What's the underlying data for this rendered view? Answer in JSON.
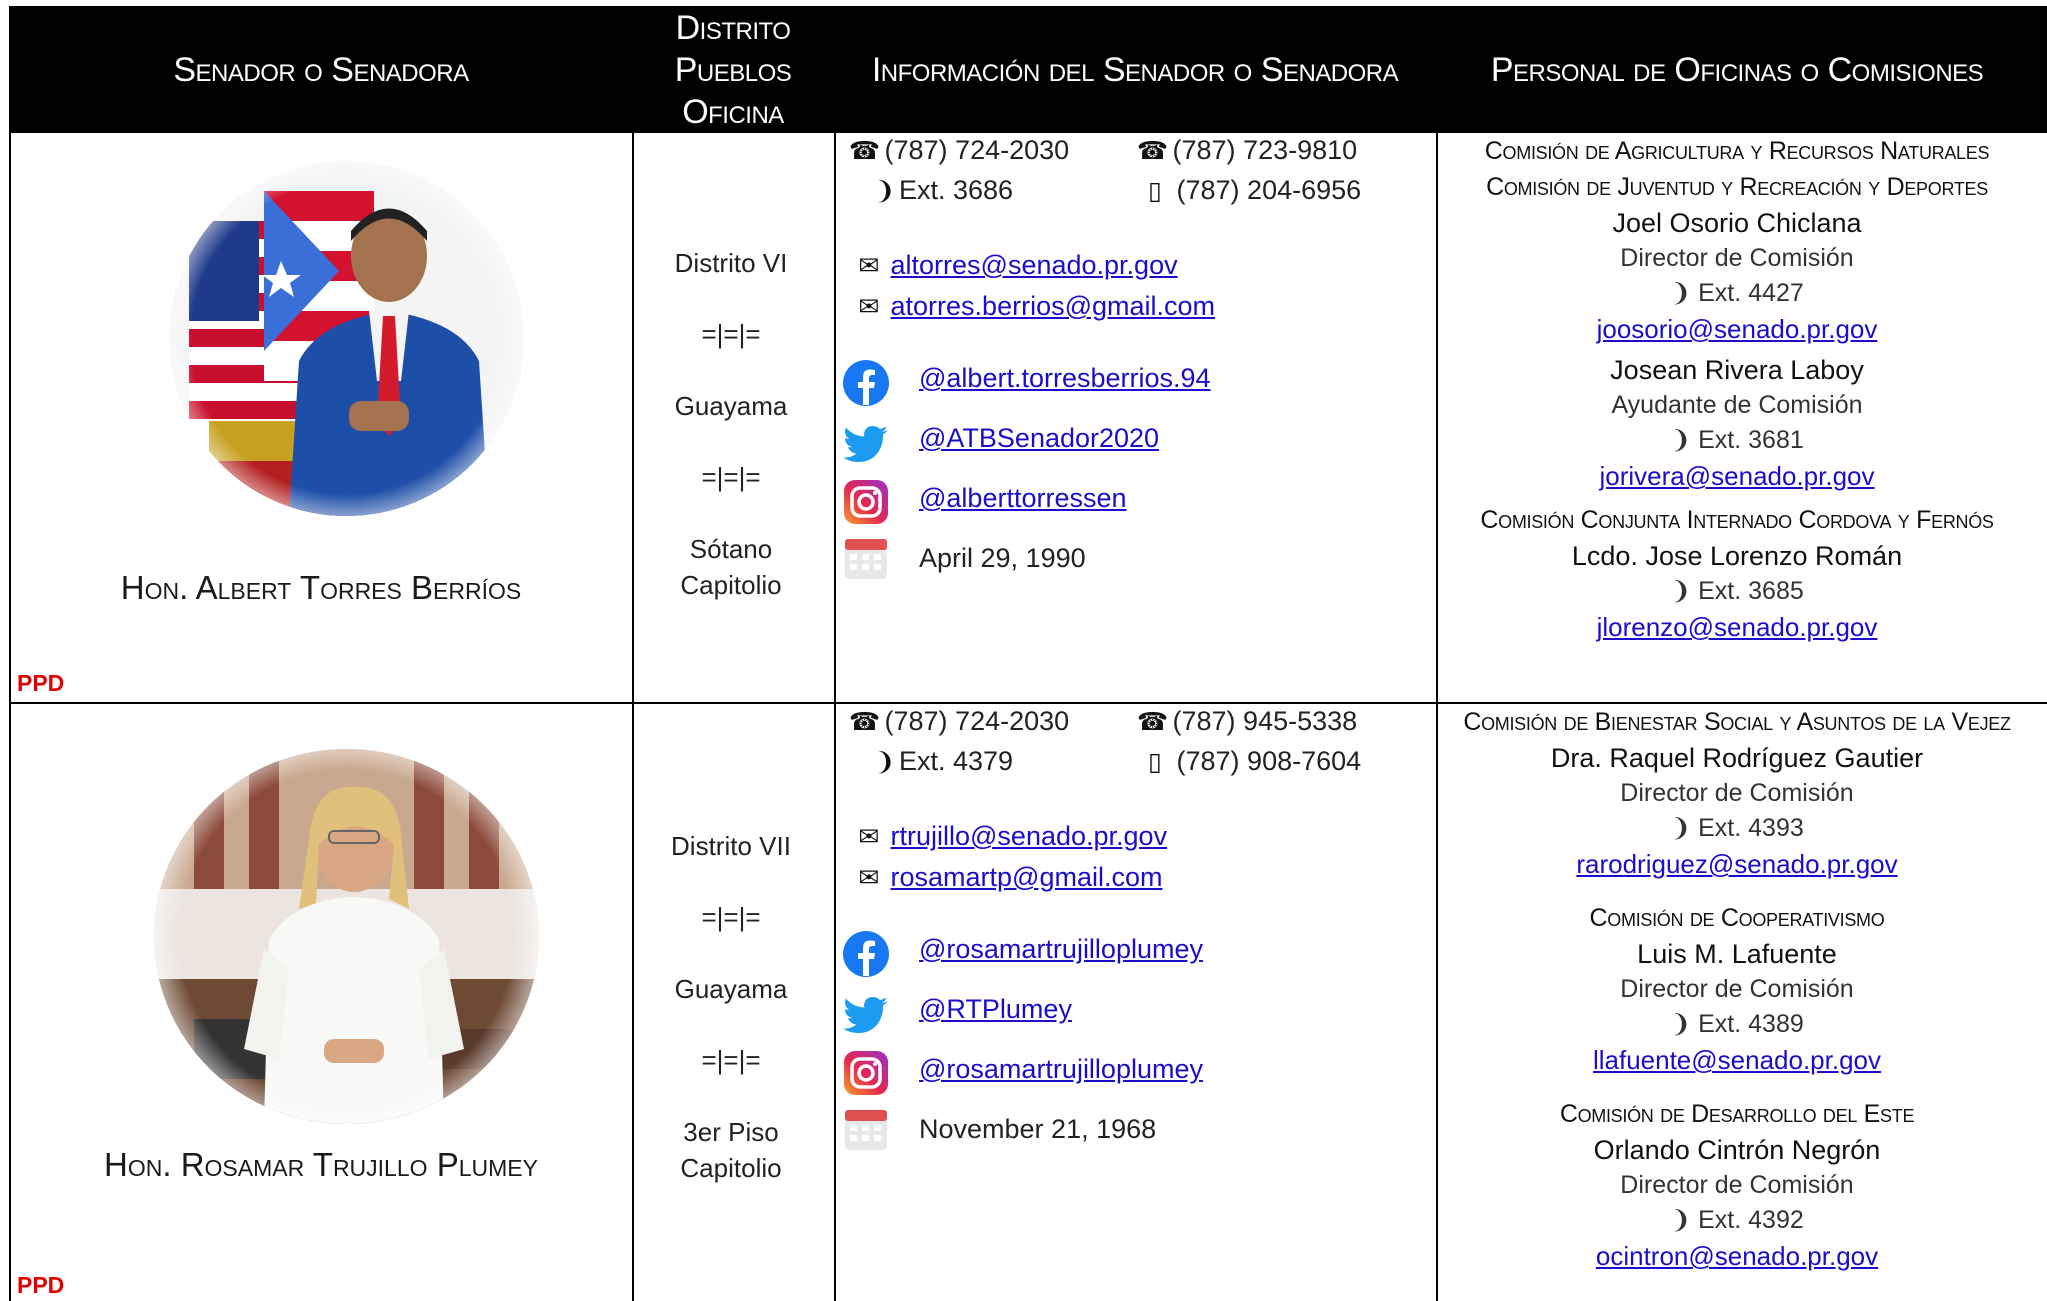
{
  "header": {
    "col1": "Senador o Senadora",
    "col2": [
      "Distrito",
      "Pueblos",
      "Oficina"
    ],
    "col3": "Información del Senador o Senadora",
    "col4": "Personal de Oficinas o Comisiones"
  },
  "separator": "=|=|=",
  "rows": [
    {
      "name": "Hon. Albert Torres Berríos",
      "party": "PPD",
      "district": "Distrito VI",
      "town": "Guayama",
      "office_line1": "Sótano",
      "office_line2": "Capitolio",
      "phone1": "(787) 724-2030",
      "ext": "Ext. 3686",
      "phone2": "(787) 723-9810",
      "mobile": "(787) 204-6956",
      "email1": "altorres@senado.pr.gov",
      "email2": "atorres.berrios@gmail.com",
      "facebook": "@albert.torresberrios.94",
      "twitter": "@ATBSenador2020",
      "instagram": "@alberttorressen",
      "birthday": "April 29, 1990",
      "staff": [
        {
          "commission": "Comisión de Agricultura y Recursos Naturales"
        },
        {
          "commission": "Comisión de Juventud y Recreación y Deportes"
        },
        {
          "name": "Joel Osorio Chiclana",
          "title": "Director de Comisión",
          "ext": "Ext. 4427",
          "email": "joosorio@senado.pr.gov"
        },
        {
          "name": "Josean Rivera Laboy",
          "title": "Ayudante de Comisión",
          "ext": "Ext. 3681",
          "email": "jorivera@senado.pr.gov"
        },
        {
          "commission": "Comisión Conjunta Internado Cordova y Fernós"
        },
        {
          "name": "Lcdo. Jose Lorenzo Román",
          "ext": "Ext. 3685",
          "email": "jlorenzo@senado.pr.gov"
        }
      ]
    },
    {
      "name": "Hon. Rosamar Trujillo Plumey",
      "party": "PPD",
      "district": "Distrito VII",
      "town": "Guayama",
      "office_line1": "3er Piso",
      "office_line2": "Capitolio",
      "phone1": "(787) 724-2030",
      "ext": "Ext. 4379",
      "phone2": "(787) 945-5338",
      "mobile": "(787) 908-7604",
      "email1": "rtrujillo@senado.pr.gov",
      "email2": "rosamartp@gmail.com",
      "facebook": "@rosamartrujilloplumey",
      "twitter": "@RTPlumey",
      "instagram": "@rosamartrujilloplumey",
      "birthday": "November 21, 1968",
      "staff": [
        {
          "commission": "Comisión de Bienestar Social y Asuntos de la Vejez"
        },
        {
          "name": "Dra. Raquel Rodríguez Gautier",
          "title": "Director de Comisión",
          "ext": "Ext. 4393",
          "email": "rarodriguez@senado.pr.gov"
        },
        {
          "commission": "Comisión de Cooperativismo"
        },
        {
          "name": "Luis M. Lafuente",
          "title": "Director de Comisión",
          "ext": "Ext. 4389",
          "email": "llafuente@senado.pr.gov"
        },
        {
          "commission": "Comisión de Desarrollo del Este"
        },
        {
          "name": "Orlando Cintrón Negrón",
          "title": "Director de Comisión",
          "ext": "Ext. 4392",
          "email": "ocintron@senado.pr.gov"
        }
      ]
    }
  ],
  "icons": {
    "phone": "phone-icon",
    "ext": "extension-icon",
    "mobile": "mobile-icon",
    "email": "email-icon",
    "facebook": "facebook-icon",
    "twitter": "twitter-icon",
    "instagram": "instagram-icon",
    "calendar": "calendar-icon"
  },
  "colors": {
    "header_bg": "#000000",
    "party": "#e00000",
    "link": "#1a0dcc",
    "facebook": "#1877f2",
    "twitter": "#1d9bf0"
  }
}
